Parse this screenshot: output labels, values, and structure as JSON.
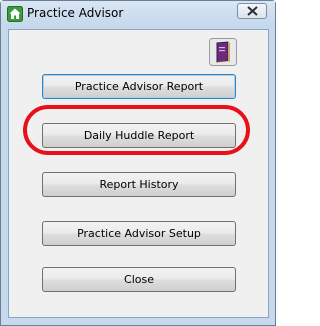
{
  "window": {
    "title": "Practice Advisor"
  },
  "icons": {
    "app": "home-icon",
    "close": "close-icon",
    "book": "book-icon"
  },
  "buttons": {
    "practice_advisor_report": "Practice Advisor Report",
    "daily_huddle_report": "Daily Huddle Report",
    "report_history": "Report History",
    "practice_advisor_setup": "Practice Advisor Setup",
    "close": "Close"
  },
  "annotation": {
    "highlight_color": "#e8101a",
    "highlighted": "daily_huddle_report"
  }
}
